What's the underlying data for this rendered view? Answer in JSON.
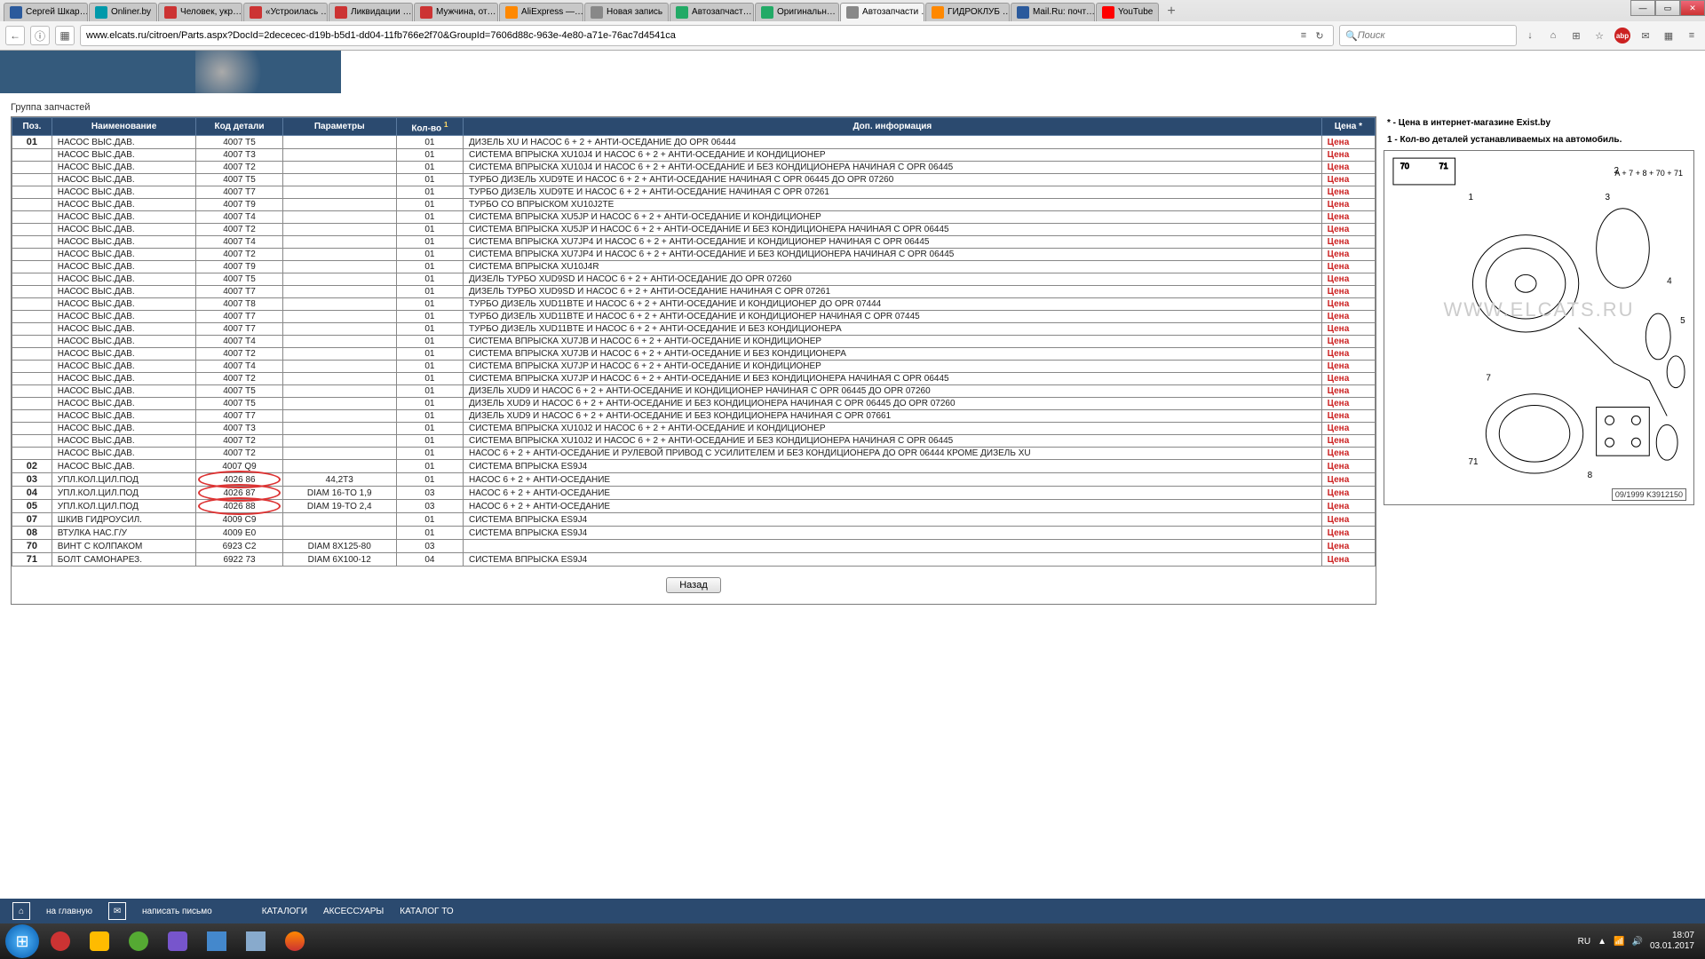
{
  "window": {
    "min": "—",
    "max": "▭",
    "close": "✕"
  },
  "tabs": [
    {
      "label": "Сергей Шкар…",
      "fav": "fav-blue"
    },
    {
      "label": "Onliner.by",
      "fav": "fav-teal"
    },
    {
      "label": "Человек, укр…",
      "fav": "fav-red"
    },
    {
      "label": "«Устроилась …",
      "fav": "fav-red"
    },
    {
      "label": "Ликвидации …",
      "fav": "fav-red"
    },
    {
      "label": "Мужчина, от…",
      "fav": "fav-red"
    },
    {
      "label": "AliExpress —…",
      "fav": "fav-orange"
    },
    {
      "label": "Новая запись",
      "fav": "fav-grey"
    },
    {
      "label": "Автозапчаст…",
      "fav": "fav-green"
    },
    {
      "label": "Оригинальн…",
      "fav": "fav-green"
    },
    {
      "label": "Автозапчасти …",
      "fav": "fav-grey",
      "active": true
    },
    {
      "label": "ГИДРОКЛУБ …",
      "fav": "fav-orange"
    },
    {
      "label": "Mail.Ru: почт…",
      "fav": "fav-blue"
    },
    {
      "label": "YouTube",
      "fav": "fav-yt"
    }
  ],
  "nav": {
    "back": "←",
    "reload": "⟳",
    "info": "ⓘ",
    "shield": "▦",
    "url": "www.elcats.ru/citroen/Parts.aspx?DocId=2dececec-d19b-b5d1-dd04-11fb766e2f70&GroupId=7606d88c-963e-4e80-a71e-76ac7d4541ca",
    "read": "≡",
    "refresh": "↻",
    "search_placeholder": "Поиск",
    "search_icon": "🔍",
    "icons": [
      "↓",
      "⌂",
      "⊞",
      "☆",
      "abp",
      "✉",
      "▦",
      "≡"
    ]
  },
  "page": {
    "group_label": "Группа запчастей",
    "headers": {
      "pos": "Поз.",
      "name": "Наименование",
      "code": "Код детали",
      "param": "Параметры",
      "qty": "Кол-во",
      "qty_sup": "1",
      "info": "Доп. информация",
      "price": "Цена *"
    },
    "price_link": "Цена",
    "legend": {
      "l1": "* - Цена в интернет-магазине Exist.by",
      "l2": "1 - Кол-во деталей устанавливаемых на автомобиль."
    },
    "diagram": {
      "note": "A + 7 + 8 + 70 + 71",
      "watermark": "WWW.ELCATS.RU",
      "footer": "09/1999  K3912150"
    },
    "back_btn": "Назад",
    "rows": [
      {
        "pos": "01",
        "name": "НАСОС ВЫС.ДАВ.",
        "code": "4007 T5",
        "param": "",
        "qty": "01",
        "info": "ДИЗЕЛЬ XU И НАСОС 6 + 2 + АНТИ-ОСЕДАНИЕ ДО OPR 06444"
      },
      {
        "pos": "",
        "name": "НАСОС ВЫС.ДАВ.",
        "code": "4007 T3",
        "param": "",
        "qty": "01",
        "info": "СИСТЕМА ВПРЫСКА XU10J4 И НАСОС 6 + 2 + АНТИ-ОСЕДАНИЕ И КОНДИЦИОНЕР"
      },
      {
        "pos": "",
        "name": "НАСОС ВЫС.ДАВ.",
        "code": "4007 T2",
        "param": "",
        "qty": "01",
        "info": "СИСТЕМА ВПРЫСКА XU10J4 И НАСОС 6 + 2 + АНТИ-ОСЕДАНИЕ И БЕЗ КОНДИЦИОНЕРА НАЧИНАЯ С OPR 06445"
      },
      {
        "pos": "",
        "name": "НАСОС ВЫС.ДАВ.",
        "code": "4007 T5",
        "param": "",
        "qty": "01",
        "info": "ТУРБО ДИЗЕЛЬ XUD9TE И НАСОС 6 + 2 + АНТИ-ОСЕДАНИЕ НАЧИНАЯ С OPR 06445 ДО OPR 07260"
      },
      {
        "pos": "",
        "name": "НАСОС ВЫС.ДАВ.",
        "code": "4007 T7",
        "param": "",
        "qty": "01",
        "info": "ТУРБО ДИЗЕЛЬ XUD9TE И НАСОС 6 + 2 + АНТИ-ОСЕДАНИЕ НАЧИНАЯ С OPR 07261"
      },
      {
        "pos": "",
        "name": "НАСОС ВЫС.ДАВ.",
        "code": "4007 T9",
        "param": "",
        "qty": "01",
        "info": "ТУРБО СО ВПРЫСКОМ XU10J2TE"
      },
      {
        "pos": "",
        "name": "НАСОС ВЫС.ДАВ.",
        "code": "4007 T4",
        "param": "",
        "qty": "01",
        "info": "СИСТЕМА ВПРЫСКА XU5JP И НАСОС 6 + 2 + АНТИ-ОСЕДАНИЕ И КОНДИЦИОНЕР"
      },
      {
        "pos": "",
        "name": "НАСОС ВЫС.ДАВ.",
        "code": "4007 T2",
        "param": "",
        "qty": "01",
        "info": "СИСТЕМА ВПРЫСКА XU5JP И НАСОС 6 + 2 + АНТИ-ОСЕДАНИЕ И БЕЗ КОНДИЦИОНЕРА НАЧИНАЯ С OPR 06445"
      },
      {
        "pos": "",
        "name": "НАСОС ВЫС.ДАВ.",
        "code": "4007 T4",
        "param": "",
        "qty": "01",
        "info": "СИСТЕМА ВПРЫСКА XU7JP4 И НАСОС 6 + 2 + АНТИ-ОСЕДАНИЕ И КОНДИЦИОНЕР НАЧИНАЯ С OPR 06445"
      },
      {
        "pos": "",
        "name": "НАСОС ВЫС.ДАВ.",
        "code": "4007 T2",
        "param": "",
        "qty": "01",
        "info": "СИСТЕМА ВПРЫСКА XU7JP4 И НАСОС 6 + 2 + АНТИ-ОСЕДАНИЕ И БЕЗ КОНДИЦИОНЕРА НАЧИНАЯ С OPR 06445"
      },
      {
        "pos": "",
        "name": "НАСОС ВЫС.ДАВ.",
        "code": "4007 T9",
        "param": "",
        "qty": "01",
        "info": "СИСТЕМА ВПРЫСКА XU10J4R"
      },
      {
        "pos": "",
        "name": "НАСОС ВЫС.ДАВ.",
        "code": "4007 T5",
        "param": "",
        "qty": "01",
        "info": "ДИЗЕЛЬ ТУРБО XUD9SD И НАСОС 6 + 2 + АНТИ-ОСЕДАНИЕ ДО OPR 07260"
      },
      {
        "pos": "",
        "name": "НАСОС ВЫС.ДАВ.",
        "code": "4007 T7",
        "param": "",
        "qty": "01",
        "info": "ДИЗЕЛЬ ТУРБО XUD9SD И НАСОС 6 + 2 + АНТИ-ОСЕДАНИЕ НАЧИНАЯ С OPR 07261"
      },
      {
        "pos": "",
        "name": "НАСОС ВЫС.ДАВ.",
        "code": "4007 T8",
        "param": "",
        "qty": "01",
        "info": "ТУРБО ДИЗЕЛЬ XUD11BTE И НАСОС 6 + 2 + АНТИ-ОСЕДАНИЕ И КОНДИЦИОНЕР ДО OPR 07444"
      },
      {
        "pos": "",
        "name": "НАСОС ВЫС.ДАВ.",
        "code": "4007 T7",
        "param": "",
        "qty": "01",
        "info": "ТУРБО ДИЗЕЛЬ XUD11BTE И НАСОС 6 + 2 + АНТИ-ОСЕДАНИЕ И КОНДИЦИОНЕР НАЧИНАЯ С OPR 07445"
      },
      {
        "pos": "",
        "name": "НАСОС ВЫС.ДАВ.",
        "code": "4007 T7",
        "param": "",
        "qty": "01",
        "info": "ТУРБО ДИЗЕЛЬ XUD11BTE И НАСОС 6 + 2 + АНТИ-ОСЕДАНИЕ И БЕЗ КОНДИЦИОНЕРА"
      },
      {
        "pos": "",
        "name": "НАСОС ВЫС.ДАВ.",
        "code": "4007 T4",
        "param": "",
        "qty": "01",
        "info": "СИСТЕМА ВПРЫСКА XU7JB И НАСОС 6 + 2 + АНТИ-ОСЕДАНИЕ И КОНДИЦИОНЕР"
      },
      {
        "pos": "",
        "name": "НАСОС ВЫС.ДАВ.",
        "code": "4007 T2",
        "param": "",
        "qty": "01",
        "info": "СИСТЕМА ВПРЫСКА XU7JB И НАСОС 6 + 2 + АНТИ-ОСЕДАНИЕ И БЕЗ КОНДИЦИОНЕРА"
      },
      {
        "pos": "",
        "name": "НАСОС ВЫС.ДАВ.",
        "code": "4007 T4",
        "param": "",
        "qty": "01",
        "info": "СИСТЕМА ВПРЫСКА XU7JP И НАСОС 6 + 2 + АНТИ-ОСЕДАНИЕ И КОНДИЦИОНЕР"
      },
      {
        "pos": "",
        "name": "НАСОС ВЫС.ДАВ.",
        "code": "4007 T2",
        "param": "",
        "qty": "01",
        "info": "СИСТЕМА ВПРЫСКА XU7JP И НАСОС 6 + 2 + АНТИ-ОСЕДАНИЕ И БЕЗ КОНДИЦИОНЕРА НАЧИНАЯ С OPR 06445"
      },
      {
        "pos": "",
        "name": "НАСОС ВЫС.ДАВ.",
        "code": "4007 T5",
        "param": "",
        "qty": "01",
        "info": "ДИЗЕЛЬ XUD9 И НАСОС 6 + 2 + АНТИ-ОСЕДАНИЕ И КОНДИЦИОНЕР НАЧИНАЯ С OPR 06445 ДО OPR 07260"
      },
      {
        "pos": "",
        "name": "НАСОС ВЫС.ДАВ.",
        "code": "4007 T5",
        "param": "",
        "qty": "01",
        "info": "ДИЗЕЛЬ XUD9 И НАСОС 6 + 2 + АНТИ-ОСЕДАНИЕ И БЕЗ КОНДИЦИОНЕРА НАЧИНАЯ С OPR 06445 ДО OPR 07260"
      },
      {
        "pos": "",
        "name": "НАСОС ВЫС.ДАВ.",
        "code": "4007 T7",
        "param": "",
        "qty": "01",
        "info": "ДИЗЕЛЬ XUD9 И НАСОС 6 + 2 + АНТИ-ОСЕДАНИЕ И БЕЗ КОНДИЦИОНЕРА НАЧИНАЯ С OPR 07661"
      },
      {
        "pos": "",
        "name": "НАСОС ВЫС.ДАВ.",
        "code": "4007 T3",
        "param": "",
        "qty": "01",
        "info": "СИСТЕМА ВПРЫСКА XU10J2 И НАСОС 6 + 2 + АНТИ-ОСЕДАНИЕ И КОНДИЦИОНЕР"
      },
      {
        "pos": "",
        "name": "НАСОС ВЫС.ДАВ.",
        "code": "4007 T2",
        "param": "",
        "qty": "01",
        "info": "СИСТЕМА ВПРЫСКА XU10J2 И НАСОС 6 + 2 + АНТИ-ОСЕДАНИЕ И БЕЗ КОНДИЦИОНЕРА НАЧИНАЯ С OPR 06445"
      },
      {
        "pos": "",
        "name": "НАСОС ВЫС.ДАВ.",
        "code": "4007 T2",
        "param": "",
        "qty": "01",
        "info": "НАСОС 6 + 2 + АНТИ-ОСЕДАНИЕ И РУЛЕВОЙ ПРИВОД С УСИЛИТЕЛЕМ И БЕЗ КОНДИЦИОНЕРА ДО OPR 06444 КРОМЕ ДИЗЕЛЬ XU"
      },
      {
        "pos": "02",
        "name": "НАСОС ВЫС.ДАВ.",
        "code": "4007 Q9",
        "param": "",
        "qty": "01",
        "info": "СИСТЕМА ВПРЫСКА ES9J4"
      },
      {
        "pos": "03",
        "name": "УПЛ.КОЛ.ЦИЛ.ПОД",
        "code": "4026 86",
        "param": "44,2T3",
        "qty": "01",
        "info": "НАСОС 6 + 2 + АНТИ-ОСЕДАНИЕ",
        "circled": true
      },
      {
        "pos": "04",
        "name": "УПЛ.КОЛ.ЦИЛ.ПОД",
        "code": "4026 87",
        "param": "DIAM 16-TO 1,9",
        "qty": "03",
        "info": "НАСОС 6 + 2 + АНТИ-ОСЕДАНИЕ",
        "circled": true
      },
      {
        "pos": "05",
        "name": "УПЛ.КОЛ.ЦИЛ.ПОД",
        "code": "4026 88",
        "param": "DIAM 19-TO 2,4",
        "qty": "03",
        "info": "НАСОС 6 + 2 + АНТИ-ОСЕДАНИЕ",
        "circled": true
      },
      {
        "pos": "07",
        "name": "ШКИВ ГИДРОУСИЛ.",
        "code": "4009 C9",
        "param": "",
        "qty": "01",
        "info": "СИСТЕМА ВПРЫСКА ES9J4"
      },
      {
        "pos": "08",
        "name": "ВТУЛКА НАС.Г/У",
        "code": "4009 E0",
        "param": "",
        "qty": "01",
        "info": "СИСТЕМА ВПРЫСКА ES9J4"
      },
      {
        "pos": "70",
        "name": "ВИНТ С КОЛПАКОМ",
        "code": "6923 C2",
        "param": "DIAM 8X125-80",
        "qty": "03",
        "info": ""
      },
      {
        "pos": "71",
        "name": "БОЛТ САМОНАРЕЗ.",
        "code": "6922 73",
        "param": "DIAM 6X100-12",
        "qty": "04",
        "info": "СИСТЕМА ВПРЫСКА ES9J4"
      }
    ]
  },
  "bottom_nav": {
    "home": "на главную",
    "mail": "написать письмо",
    "items": [
      "КАТАЛОГИ",
      "АКСЕССУАРЫ",
      "КАТАЛОГ ТО"
    ]
  },
  "taskbar": {
    "lang": "RU",
    "time": "18:07",
    "date": "03.01.2017"
  }
}
